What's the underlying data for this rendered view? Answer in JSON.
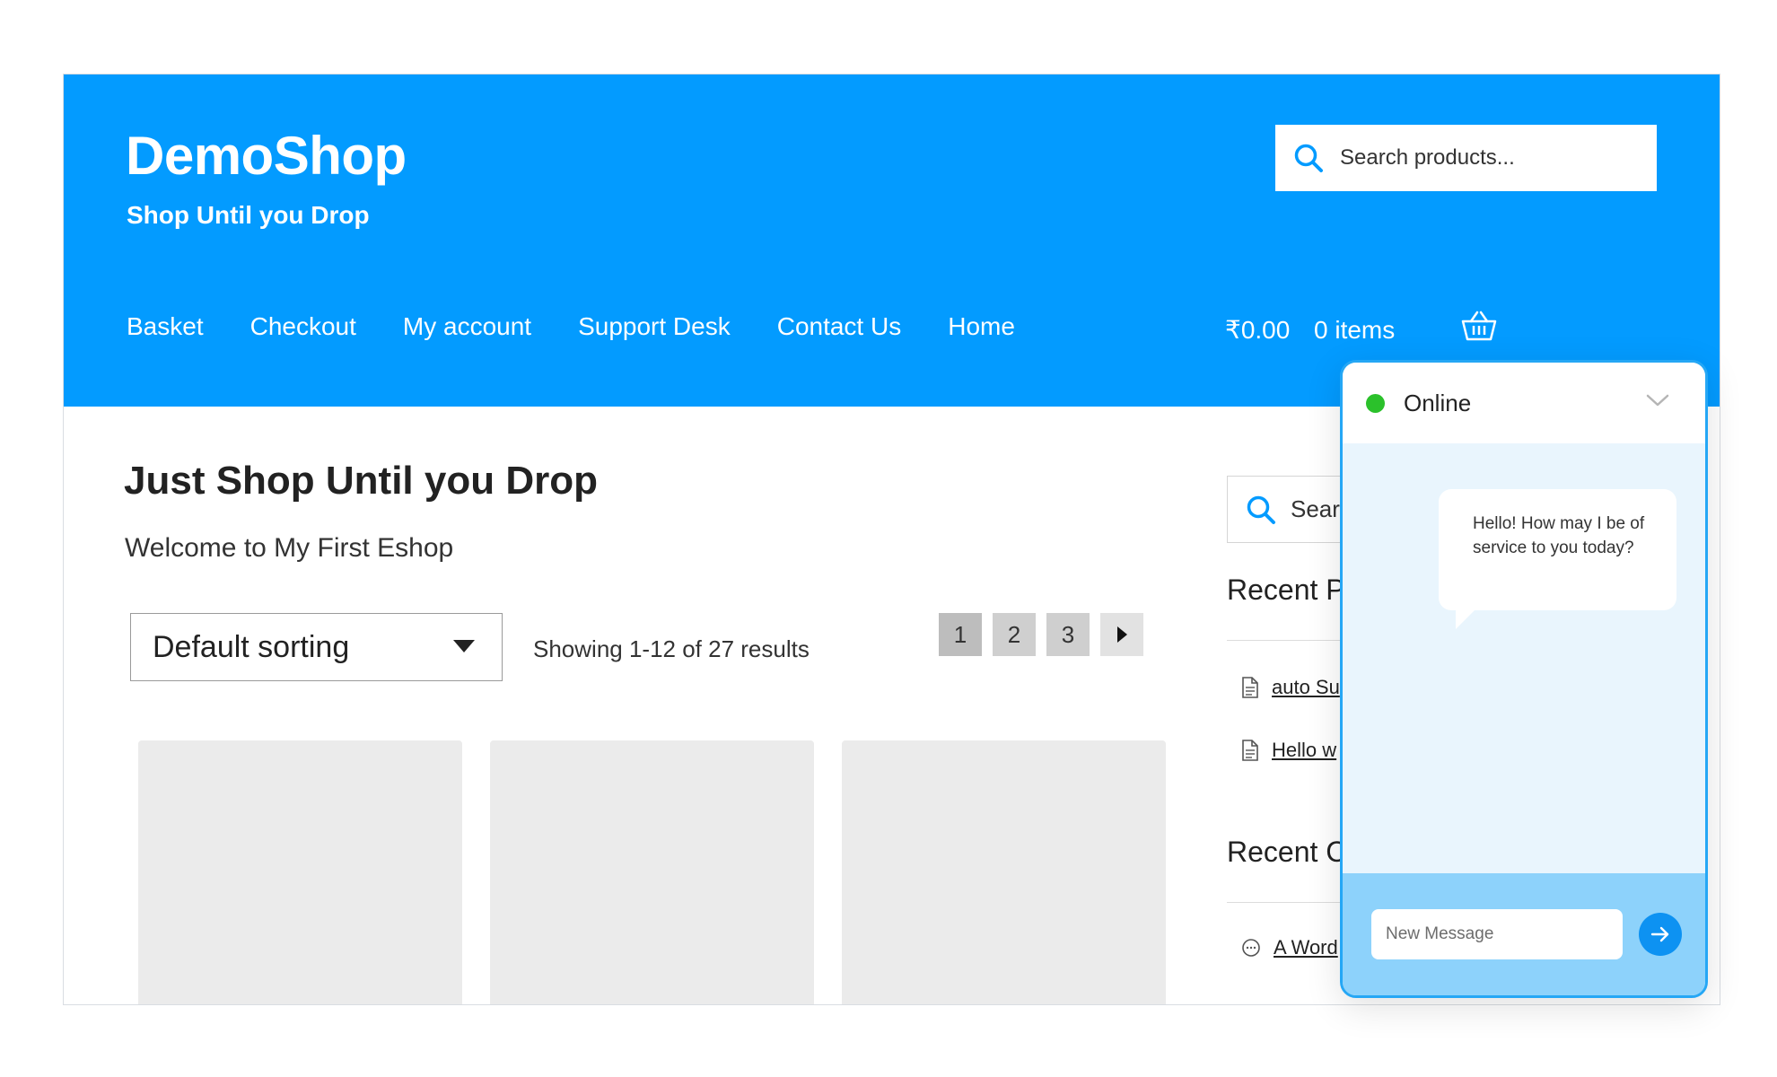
{
  "header": {
    "title": "DemoShop",
    "tagline": "Shop Until you Drop",
    "search_placeholder": "Search products..."
  },
  "nav": {
    "items": [
      "Basket",
      "Checkout",
      "My account",
      "Support Desk",
      "Contact Us",
      "Home"
    ]
  },
  "cart": {
    "total": "₹0.00",
    "items": "0 items"
  },
  "main": {
    "heading": "Just Shop Until you Drop",
    "welcome": "Welcome to My First Eshop",
    "sorting": {
      "selected": "Default sorting"
    },
    "result_count": "Showing 1-12 of 27 results",
    "pages": [
      "1",
      "2",
      "3"
    ]
  },
  "sidebar": {
    "search_text": "Sear",
    "recent_posts_title": "Recent P",
    "recent_posts": [
      "auto Su",
      "Hello w"
    ],
    "recent_comments_title": "Recent C",
    "recent_comments": [
      "A Word"
    ]
  },
  "chat": {
    "status": "Online",
    "message": "Hello! How may I be of service to you today?",
    "input_placeholder": "New Message"
  },
  "colors": {
    "brand_blue": "#039bff",
    "chat_border": "#25a7f5",
    "online_green": "#2bc12b",
    "send_button": "#0d92f2"
  }
}
